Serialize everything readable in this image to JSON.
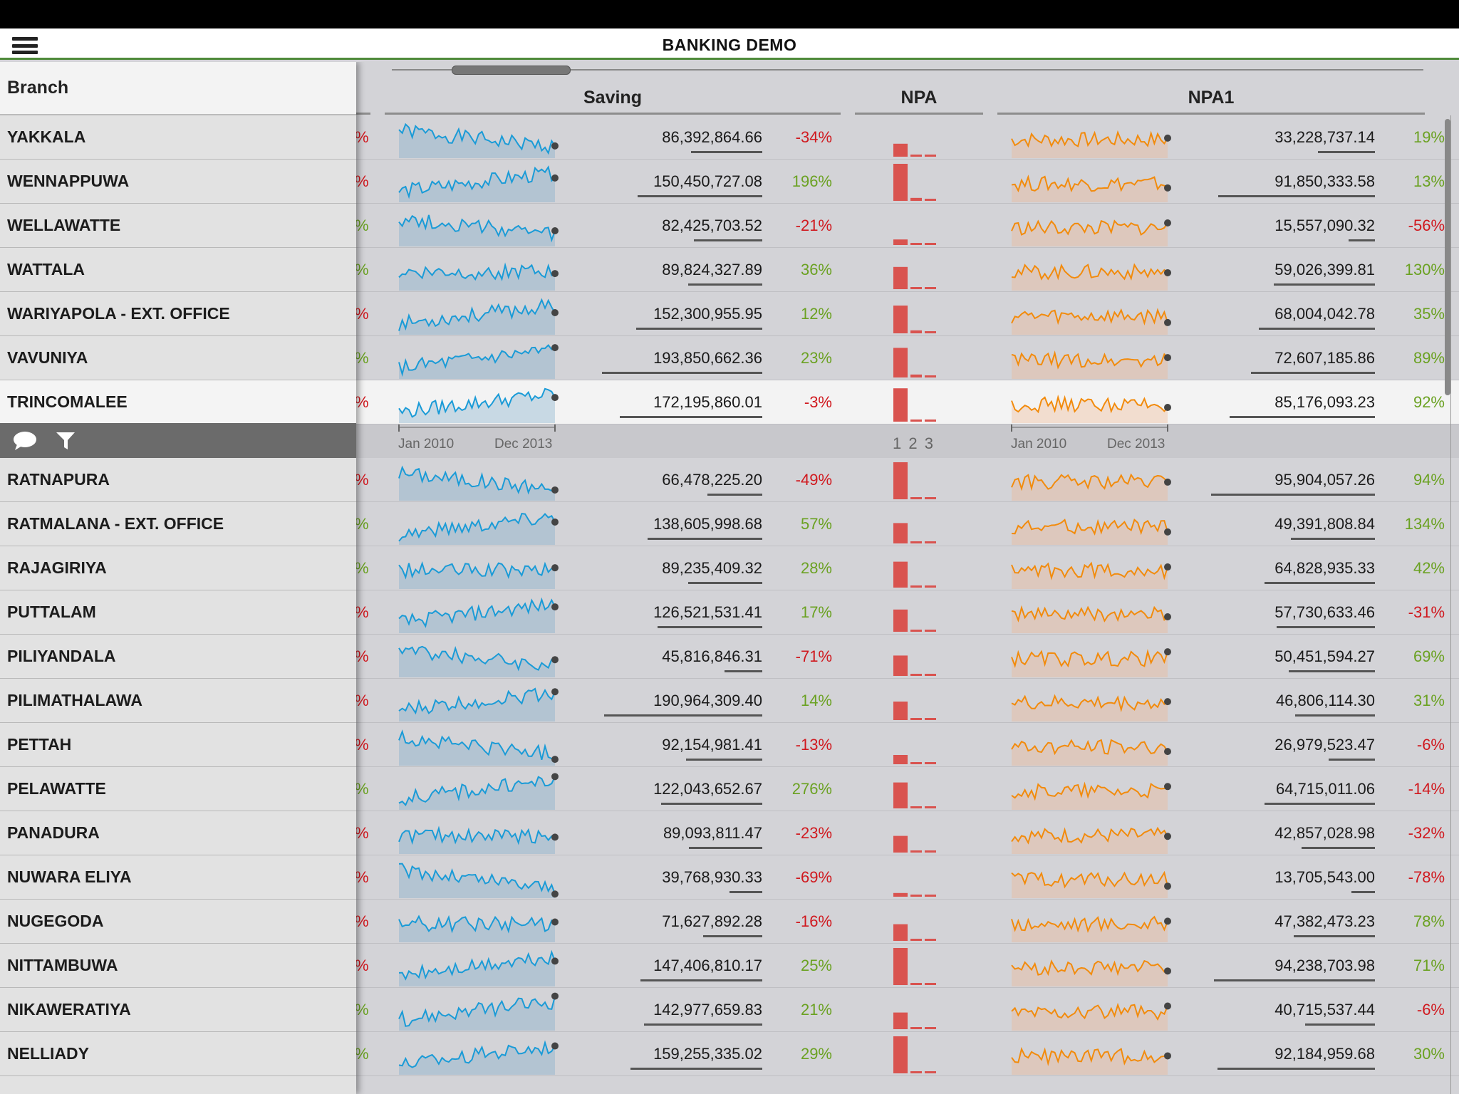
{
  "app": {
    "title": "BANKING DEMO"
  },
  "left_panel": {
    "header": "Branch"
  },
  "columns": {
    "saving": "Saving",
    "npa": "NPA",
    "npa1": "NPA1"
  },
  "axis": {
    "saving_start": "Jan 2010",
    "saving_end": "Dec 2013",
    "npa_ticks": "1 2 3",
    "npa1_start": "Jan 2010",
    "npa1_end": "Dec 2013"
  },
  "colors": {
    "saving_line": "#1a9bd7",
    "npa1_line": "#f28b0c",
    "npa_bar": "#d9534f",
    "positive": "#6aa121",
    "negative": "#d0181e",
    "nav_accent": "#4e8a3a"
  },
  "icons": {
    "menu": "menu-icon",
    "comment": "comment-icon",
    "filter": "filter-icon"
  },
  "rows_top": [
    {
      "branch": "YAKKALA",
      "cut_pct_sign": "neg",
      "saving": "86,392,864.66",
      "saving_pct": "-34%",
      "saving_trend": "down",
      "npa": [
        0.35,
        0.03,
        0.03
      ],
      "npa1": "33,228,737.14",
      "npa1_pct": "19%"
    },
    {
      "branch": "WENNAPPUWA",
      "cut_pct_sign": "neg",
      "saving": "150,450,727.08",
      "saving_pct": "196%",
      "saving_trend": "up",
      "npa": [
        1.0,
        0.08,
        0.03
      ],
      "npa1": "91,850,333.58",
      "npa1_pct": "13%"
    },
    {
      "branch": "WELLAWATTE",
      "cut_pct_sign": "pos",
      "saving": "82,425,703.52",
      "saving_pct": "-21%",
      "saving_trend": "down",
      "npa": [
        0.15,
        0.03,
        0.03
      ],
      "npa1": "15,557,090.32",
      "npa1_pct": "-56%"
    },
    {
      "branch": "WATTALA",
      "cut_pct_sign": "pos",
      "saving": "89,824,327.89",
      "saving_pct": "36%",
      "saving_trend": "flat",
      "npa": [
        0.6,
        0.03,
        0.03
      ],
      "npa1": "59,026,399.81",
      "npa1_pct": "130%"
    },
    {
      "branch": "WARIYAPOLA - EXT. OFFICE",
      "cut_pct_sign": "neg",
      "saving": "152,300,955.95",
      "saving_pct": "12%",
      "saving_trend": "up",
      "npa": [
        0.75,
        0.08,
        0.03
      ],
      "npa1": "68,004,042.78",
      "npa1_pct": "35%"
    },
    {
      "branch": "VAVUNIYA",
      "cut_pct_sign": "pos",
      "saving": "193,850,662.36",
      "saving_pct": "23%",
      "saving_trend": "up",
      "npa": [
        0.8,
        0.08,
        0.03
      ],
      "npa1": "72,607,185.86",
      "npa1_pct": "89%"
    },
    {
      "branch": "TRINCOMALEE",
      "cut_pct_sign": "neg",
      "saving": "172,195,860.01",
      "saving_pct": "-3%",
      "saving_trend": "up",
      "npa": [
        0.9,
        0.03,
        0.03
      ],
      "npa1": "85,176,093.23",
      "npa1_pct": "92%",
      "selected": true
    }
  ],
  "rows_bottom": [
    {
      "branch": "RATNAPURA",
      "cut_pct_sign": "neg",
      "saving": "66,478,225.20",
      "saving_pct": "-49%",
      "saving_trend": "down",
      "npa": [
        1.0,
        0.03,
        0.03
      ],
      "npa1": "95,904,057.26",
      "npa1_pct": "94%"
    },
    {
      "branch": "RATMALANA - EXT. OFFICE",
      "cut_pct_sign": "pos",
      "saving": "138,605,998.68",
      "saving_pct": "57%",
      "saving_trend": "up",
      "npa": [
        0.55,
        0.03,
        0.03
      ],
      "npa1": "49,391,808.84",
      "npa1_pct": "134%"
    },
    {
      "branch": "RAJAGIRIYA",
      "cut_pct_sign": "pos",
      "saving": "89,235,409.32",
      "saving_pct": "28%",
      "saving_trend": "flat",
      "npa": [
        0.7,
        0.03,
        0.03
      ],
      "npa1": "64,828,935.33",
      "npa1_pct": "42%"
    },
    {
      "branch": "PUTTALAM",
      "cut_pct_sign": "neg",
      "saving": "126,521,531.41",
      "saving_pct": "17%",
      "saving_trend": "up",
      "npa": [
        0.6,
        0.03,
        0.03
      ],
      "npa1": "57,730,633.46",
      "npa1_pct": "-31%"
    },
    {
      "branch": "PILIYANDALA",
      "cut_pct_sign": "neg",
      "saving": "45,816,846.31",
      "saving_pct": "-71%",
      "saving_trend": "down",
      "npa": [
        0.55,
        0.03,
        0.03
      ],
      "npa1": "50,451,594.27",
      "npa1_pct": "69%"
    },
    {
      "branch": "PILIMATHALAWA",
      "cut_pct_sign": "neg",
      "saving": "190,964,309.40",
      "saving_pct": "14%",
      "saving_trend": "up",
      "npa": [
        0.5,
        0.03,
        0.03
      ],
      "npa1": "46,806,114.30",
      "npa1_pct": "31%"
    },
    {
      "branch": "PETTAH",
      "cut_pct_sign": "neg",
      "saving": "92,154,981.41",
      "saving_pct": "-13%",
      "saving_trend": "down",
      "npa": [
        0.25,
        0.03,
        0.03
      ],
      "npa1": "26,979,523.47",
      "npa1_pct": "-6%"
    },
    {
      "branch": "PELAWATTE",
      "cut_pct_sign": "pos",
      "saving": "122,043,652.67",
      "saving_pct": "276%",
      "saving_trend": "up",
      "npa": [
        0.7,
        0.03,
        0.03
      ],
      "npa1": "64,715,011.06",
      "npa1_pct": "-14%"
    },
    {
      "branch": "PANADURA",
      "cut_pct_sign": "neg",
      "saving": "89,093,811.47",
      "saving_pct": "-23%",
      "saving_trend": "flat",
      "npa": [
        0.45,
        0.03,
        0.03
      ],
      "npa1": "42,857,028.98",
      "npa1_pct": "-32%"
    },
    {
      "branch": "NUWARA ELIYA",
      "cut_pct_sign": "neg",
      "saving": "39,768,930.33",
      "saving_pct": "-69%",
      "saving_trend": "down",
      "npa": [
        0.1,
        0.03,
        0.03
      ],
      "npa1": "13,705,543.00",
      "npa1_pct": "-78%"
    },
    {
      "branch": "NUGEGODA",
      "cut_pct_sign": "neg",
      "saving": "71,627,892.28",
      "saving_pct": "-16%",
      "saving_trend": "flat",
      "npa": [
        0.45,
        0.03,
        0.03
      ],
      "npa1": "47,382,473.23",
      "npa1_pct": "78%"
    },
    {
      "branch": "NITTAMBUWA",
      "cut_pct_sign": "neg",
      "saving": "147,406,810.17",
      "saving_pct": "25%",
      "saving_trend": "up",
      "npa": [
        1.0,
        0.03,
        0.03
      ],
      "npa1": "94,238,703.98",
      "npa1_pct": "71%"
    },
    {
      "branch": "NIKAWERATIYA",
      "cut_pct_sign": "pos",
      "saving": "142,977,659.83",
      "saving_pct": "21%",
      "saving_trend": "up",
      "npa": [
        0.45,
        0.03,
        0.03
      ],
      "npa1": "40,715,537.44",
      "npa1_pct": "-6%"
    },
    {
      "branch": "NELLIADY",
      "cut_pct_sign": "pos",
      "saving": "159,255,335.02",
      "saving_pct": "29%",
      "saving_trend": "up",
      "npa": [
        1.0,
        0.03,
        0.03
      ],
      "npa1": "92,184,959.68",
      "npa1_pct": "30%"
    }
  ]
}
